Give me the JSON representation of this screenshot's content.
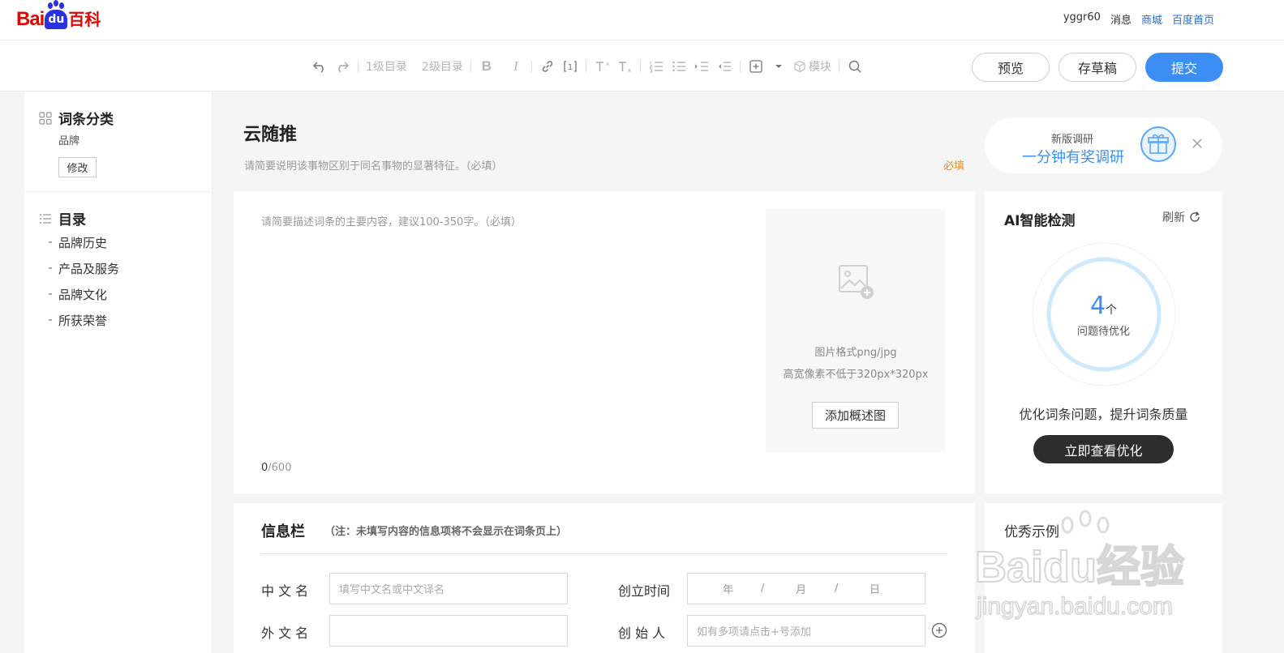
{
  "header": {
    "logo_text": "Bai",
    "logo_du": "du",
    "logo_name": "百科",
    "user": "yggr60",
    "links": {
      "messages": "消息",
      "mall": "商城",
      "home": "百度首页"
    }
  },
  "toolbar": {
    "heading1": "1级目录",
    "heading2": "2级目录",
    "bold": "B",
    "italic": "I",
    "module": "模块",
    "preview": "预览",
    "draft": "存草稿",
    "submit": "提交"
  },
  "sidebar": {
    "category_title": "词条分类",
    "category_value": "品牌",
    "modify": "修改",
    "toc_title": "目录",
    "toc": [
      "品牌历史",
      "产品及服务",
      "品牌文化",
      "所获荣誉"
    ]
  },
  "main": {
    "title": "云随推",
    "title_tip": "请简要说明该事物区别于同名事物的显著特征。（必填）",
    "required": "必填",
    "summary_placeholder": "请简要描述词条的主要内容，建议100-350字。（必填）",
    "counter_current": "0",
    "counter_max": "/600",
    "image_format": "图片格式png/jpg",
    "image_size": "高宽像素不低于320px*320px",
    "add_image": "添加概述图"
  },
  "info": {
    "title": "信息栏",
    "note": "（注：未填写内容的信息项将不会显示在词条页上）",
    "fields": {
      "cn_name_label": "中 文 名",
      "cn_name_placeholder": "填写中文名或中文译名",
      "en_name_label": "外 文 名",
      "founded_label": "创立时间",
      "year": "年",
      "month": "月",
      "day": "日",
      "slash": "/",
      "founder_label": "创 始 人",
      "founder_placeholder": "如有多项请点击+号添加"
    }
  },
  "survey": {
    "line1": "新版调研",
    "line2": "一分钟有奖调研"
  },
  "ai": {
    "title": "AI智能检测",
    "refresh": "刷新",
    "count": "4",
    "unit": "个",
    "sub": "问题待优化",
    "desc": "优化词条问题，提升词条质量",
    "button": "立即查看优化"
  },
  "examples": {
    "title": "优秀示例"
  },
  "watermark": {
    "line1": "Baidu经验",
    "line2": "jingyan.baidu.com"
  },
  "colors": {
    "accent": "#3d8ef4",
    "brand_red": "#e10601",
    "required_orange": "#f28b1f"
  }
}
